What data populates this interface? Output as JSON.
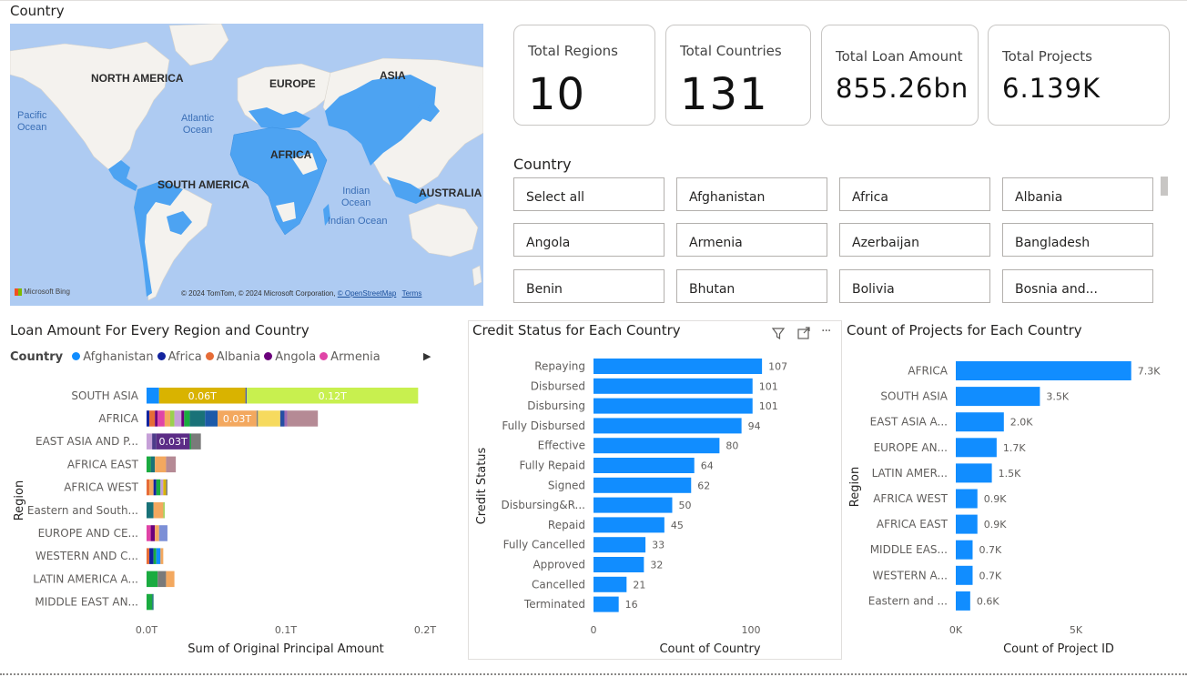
{
  "map": {
    "title": "Country",
    "continents": {
      "north_america": "NORTH AMERICA",
      "europe": "EUROPE",
      "asia": "ASIA",
      "africa": "AFRICA",
      "south_america": "SOUTH AMERICA",
      "australia": "AUSTRALIA"
    },
    "oceans": {
      "pacific": "Pacific\nOcean",
      "atlantic": "Atlantic\nOcean",
      "indian1": "Indian\nOcean",
      "indian2": "Indian Ocean"
    },
    "logo": "Microsoft Bing",
    "attribution": "© 2024 TomTom, © 2024 Microsoft Corporation,",
    "osm": "© OpenStreetMap",
    "terms": "Terms",
    "colors": {
      "water": "#aecbf2",
      "land": "#f4f2ee",
      "highlight": "#4da3f2"
    }
  },
  "cards": [
    {
      "title": "Total Regions",
      "value": "10"
    },
    {
      "title": "Total Countries",
      "value": "131"
    },
    {
      "title": "Total Loan Amount",
      "value": "855.26bn"
    },
    {
      "title": "Total Projects",
      "value": "6.139K"
    }
  ],
  "slicer": {
    "title": "Country",
    "items": [
      "Select all",
      "Afghanistan",
      "Africa",
      "Albania",
      "Angola",
      "Armenia",
      "Azerbaijan",
      "Bangladesh",
      "Benin",
      "Bhutan",
      "Bolivia",
      "Bosnia and..."
    ]
  },
  "loan_chart": {
    "title": "Loan Amount For Every Region and Country",
    "legend_title": "Country",
    "legend": [
      {
        "name": "Afghanistan",
        "color": "#118dff"
      },
      {
        "name": "Africa",
        "color": "#12239e"
      },
      {
        "name": "Albania",
        "color": "#e66c37"
      },
      {
        "name": "Angola",
        "color": "#6b007b"
      },
      {
        "name": "Armenia",
        "color": "#e044a7"
      }
    ],
    "more_icon": "play-right-icon"
  },
  "credit_chart": {
    "title": "Credit Status for Each Country",
    "icons": [
      "filter-icon",
      "focus-mode-icon",
      "more-options-icon"
    ]
  },
  "projects_chart": {
    "title": "Count of Projects for Each Country"
  },
  "chart_data": [
    {
      "type": "bar",
      "orientation": "horizontal",
      "stacked": true,
      "title": "Loan Amount For Every Region and Country",
      "xlabel": "Sum of Original Principal Amount",
      "ylabel": "Region",
      "x_ticks": [
        "0.0T",
        "0.1T",
        "0.2T"
      ],
      "xlim": [
        0,
        0.2
      ],
      "categories": [
        "SOUTH ASIA",
        "AFRICA",
        "EAST ASIA AND P...",
        "AFRICA EAST",
        "AFRICA WEST",
        "Eastern and South...",
        "EUROPE AND CE...",
        "WESTERN AND C...",
        "LATIN AMERICA A...",
        "MIDDLE EAST AN..."
      ],
      "segments": [
        [
          {
            "v": 0.009,
            "c": "#118dff"
          },
          {
            "v": 0.062,
            "c": "#d9b300",
            "label": "0.06T"
          },
          {
            "v": 0.001,
            "c": "#4b5aa8"
          },
          {
            "v": 0.123,
            "c": "#c8f04f",
            "label": "0.12T"
          }
        ],
        [
          {
            "v": 0.002,
            "c": "#12239e"
          },
          {
            "v": 0.004,
            "c": "#e66c37"
          },
          {
            "v": 0.002,
            "c": "#6b007b"
          },
          {
            "v": 0.005,
            "c": "#e044a7"
          },
          {
            "v": 0.004,
            "c": "#f3a85f"
          },
          {
            "v": 0.003,
            "c": "#9ad04f"
          },
          {
            "v": 0.005,
            "c": "#c6a0d8"
          },
          {
            "v": 0.002,
            "c": "#6b007b"
          },
          {
            "v": 0.004,
            "c": "#1aab40"
          },
          {
            "v": 0.011,
            "c": "#197278"
          },
          {
            "v": 0.009,
            "c": "#1c5aa8"
          },
          {
            "v": 0.028,
            "c": "#f3a85f",
            "label": "0.03T"
          },
          {
            "v": 0.001,
            "c": "#7f7f7f"
          },
          {
            "v": 0.016,
            "c": "#f6da5e"
          },
          {
            "v": 0.003,
            "c": "#254ea3"
          },
          {
            "v": 0.002,
            "c": "#a06bb4"
          },
          {
            "v": 0.022,
            "c": "#b58a95"
          }
        ],
        [
          {
            "v": 0.004,
            "c": "#c6a0d8"
          },
          {
            "v": 0.003,
            "c": "#4d3b8a"
          },
          {
            "v": 0.024,
            "c": "#5b2c86",
            "label": "0.03T"
          },
          {
            "v": 0.001,
            "c": "#1aab40"
          },
          {
            "v": 0.007,
            "c": "#7a7a7a"
          }
        ],
        [
          {
            "v": 0.003,
            "c": "#1aab40"
          },
          {
            "v": 0.003,
            "c": "#197278"
          },
          {
            "v": 0.008,
            "c": "#f3a85f"
          },
          {
            "v": 0.007,
            "c": "#b58a95"
          }
        ],
        [
          {
            "v": 0.002,
            "c": "#e66c37"
          },
          {
            "v": 0.003,
            "c": "#f3a85f"
          },
          {
            "v": 0.002,
            "c": "#12239e"
          },
          {
            "v": 0.003,
            "c": "#1aab40"
          },
          {
            "v": 0.002,
            "c": "#c6a0d8"
          },
          {
            "v": 0.002,
            "c": "#d9b300"
          },
          {
            "v": 0.001,
            "c": "#7a7a7a"
          }
        ],
        [
          {
            "v": 0.005,
            "c": "#197278"
          },
          {
            "v": 0.007,
            "c": "#f3a85f"
          },
          {
            "v": 0.001,
            "c": "#9ad04f"
          }
        ],
        [
          {
            "v": 0.003,
            "c": "#e044a7"
          },
          {
            "v": 0.003,
            "c": "#6b007b"
          },
          {
            "v": 0.003,
            "c": "#f3a85f"
          },
          {
            "v": 0.006,
            "c": "#7c8fd6"
          }
        ],
        [
          {
            "v": 0.002,
            "c": "#e66c37"
          },
          {
            "v": 0.003,
            "c": "#12239e"
          },
          {
            "v": 0.002,
            "c": "#1aab40"
          },
          {
            "v": 0.003,
            "c": "#118dff"
          },
          {
            "v": 0.002,
            "c": "#f3a85f"
          }
        ],
        [
          {
            "v": 0.008,
            "c": "#1aab40"
          },
          {
            "v": 0.006,
            "c": "#7a7a7a"
          },
          {
            "v": 0.006,
            "c": "#f3a85f"
          }
        ],
        [
          {
            "v": 0.004,
            "c": "#1aab40"
          },
          {
            "v": 0.001,
            "c": "#197278"
          }
        ]
      ]
    },
    {
      "type": "bar",
      "orientation": "horizontal",
      "title": "Credit Status for Each Country",
      "xlabel": "Count of Country",
      "ylabel": "Credit Status",
      "x_ticks": [
        "0",
        "100"
      ],
      "xlim": [
        0,
        115
      ],
      "categories": [
        "Repaying",
        "Disbursed",
        "Disbursing",
        "Fully Disbursed",
        "Effective",
        "Fully Repaid",
        "Signed",
        "Disbursing&R...",
        "Repaid",
        "Fully Cancelled",
        "Approved",
        "Cancelled",
        "Terminated"
      ],
      "values": [
        107,
        101,
        101,
        94,
        80,
        64,
        62,
        50,
        45,
        33,
        32,
        21,
        16
      ],
      "labels": [
        "107",
        "101",
        "101",
        "94",
        "80",
        "64",
        "62",
        "50",
        "45",
        "33",
        "32",
        "21",
        "16"
      ],
      "color": "#118dff"
    },
    {
      "type": "bar",
      "orientation": "horizontal",
      "title": "Count of Projects for Each Country",
      "xlabel": "Count of Project ID",
      "ylabel": "Region",
      "x_ticks": [
        "0K",
        "5K"
      ],
      "xlim": [
        0,
        8000
      ],
      "categories": [
        "AFRICA",
        "SOUTH ASIA",
        "EAST ASIA A...",
        "EUROPE AN...",
        "LATIN AMER...",
        "AFRICA WEST",
        "AFRICA EAST",
        "MIDDLE EAS...",
        "WESTERN A...",
        "Eastern and ..."
      ],
      "values": [
        7300,
        3500,
        2000,
        1700,
        1500,
        900,
        900,
        700,
        700,
        600
      ],
      "labels": [
        "7.3K",
        "3.5K",
        "2.0K",
        "1.7K",
        "1.5K",
        "0.9K",
        "0.9K",
        "0.7K",
        "0.7K",
        "0.6K"
      ],
      "color": "#118dff"
    }
  ]
}
